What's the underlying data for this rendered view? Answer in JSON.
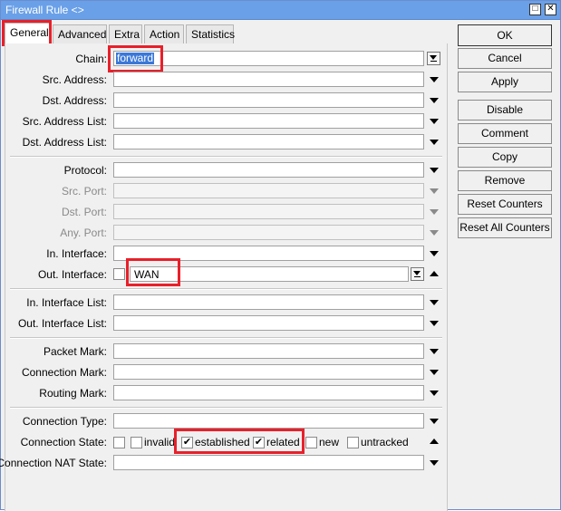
{
  "window": {
    "title": "Firewall Rule <>",
    "restore_glyph": "□",
    "close_glyph": "✕"
  },
  "tabs": [
    {
      "label": "General",
      "active": true
    },
    {
      "label": "Advanced"
    },
    {
      "label": "Extra"
    },
    {
      "label": "Action"
    },
    {
      "label": "Statistics"
    }
  ],
  "fields": {
    "chain": {
      "label": "Chain:",
      "value": "forward"
    },
    "src_address": {
      "label": "Src. Address:",
      "value": ""
    },
    "dst_address": {
      "label": "Dst. Address:",
      "value": ""
    },
    "src_address_list": {
      "label": "Src. Address List:",
      "value": ""
    },
    "dst_address_list": {
      "label": "Dst. Address List:",
      "value": ""
    },
    "protocol": {
      "label": "Protocol:",
      "value": ""
    },
    "src_port": {
      "label": "Src. Port:",
      "value": ""
    },
    "dst_port": {
      "label": "Dst. Port:",
      "value": ""
    },
    "any_port": {
      "label": "Any. Port:",
      "value": ""
    },
    "in_interface": {
      "label": "In. Interface:",
      "value": ""
    },
    "out_interface": {
      "label": "Out. Interface:",
      "value": "WAN"
    },
    "in_interface_list": {
      "label": "In. Interface List:",
      "value": ""
    },
    "out_interface_list": {
      "label": "Out. Interface List:",
      "value": ""
    },
    "packet_mark": {
      "label": "Packet Mark:",
      "value": ""
    },
    "connection_mark": {
      "label": "Connection Mark:",
      "value": ""
    },
    "routing_mark": {
      "label": "Routing Mark:",
      "value": ""
    },
    "connection_type": {
      "label": "Connection Type:",
      "value": ""
    },
    "connection_state": {
      "label": "Connection State:",
      "options": [
        {
          "label": "invalid",
          "checked": false
        },
        {
          "label": "established",
          "checked": true
        },
        {
          "label": "related",
          "checked": true
        },
        {
          "label": "new",
          "checked": false
        },
        {
          "label": "untracked",
          "checked": false
        }
      ]
    },
    "connection_nat_state": {
      "label": "Connection NAT State:",
      "value": ""
    }
  },
  "buttons": {
    "ok": "OK",
    "cancel": "Cancel",
    "apply": "Apply",
    "disable": "Disable",
    "comment": "Comment",
    "copy": "Copy",
    "remove": "Remove",
    "reset_counters": "Reset Counters",
    "reset_all_counters": "Reset All Counters"
  },
  "colors": {
    "titlebar": "#6aa0e8",
    "highlight": "#e8202a",
    "selection": "#3b78d8"
  }
}
